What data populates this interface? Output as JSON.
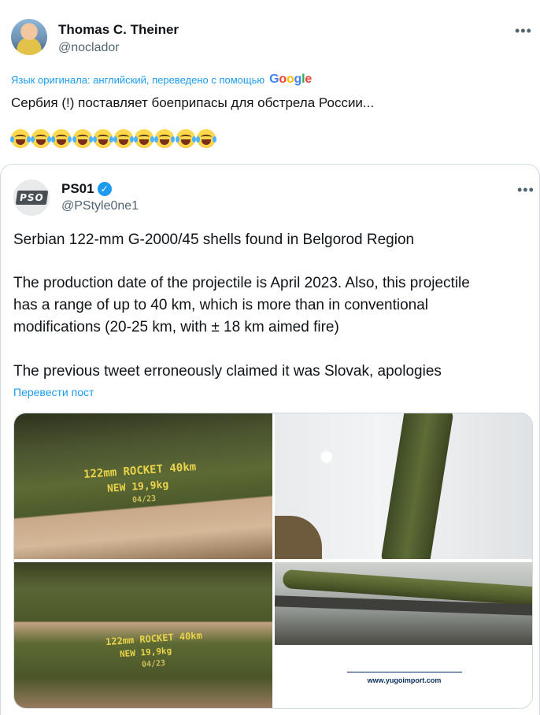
{
  "tweet": {
    "author_name": "Thomas C. Theiner",
    "author_handle": "@noclador",
    "more_icon": "more-icon",
    "translation_note": "Язык оригинала: английский, переведено с помощью",
    "google_logo": [
      "G",
      "o",
      "o",
      "g",
      "l",
      "e"
    ],
    "text": "Сербия (!) поставляет боеприпасы для обстрела России...",
    "emoji_name": "face-with-tears-of-joy",
    "emoji_count": 10
  },
  "quote": {
    "author_name": "PS01",
    "avatar_logo": "PSO",
    "verified_icon": "verified-badge-icon",
    "author_handle": "@PStyle0ne1",
    "more_icon": "more-icon",
    "lines": [
      "Serbian 122-mm G-2000/45 shells found in Belgorod Region",
      "The production date of the projectile is April 2023. Also, this projectile",
      "has a range of up to 40 km, which is more than in conventional",
      "modifications (20-25 km, with ± 18 km aimed fire)",
      "The previous tweet erroneously claimed it was Slovak, apologies"
    ],
    "translate_link": "Перевести пост",
    "images": {
      "img1": {
        "line1": "122mm ROCKET 40km",
        "line2": "NEW 19,9kg",
        "line3": "04/23"
      },
      "img3": {
        "line1": "122mm ROCKET 40km",
        "line2": "NEW 19,9kg",
        "line3": "04/23"
      },
      "img4": {
        "url": "www.yugoimport.com"
      }
    }
  }
}
